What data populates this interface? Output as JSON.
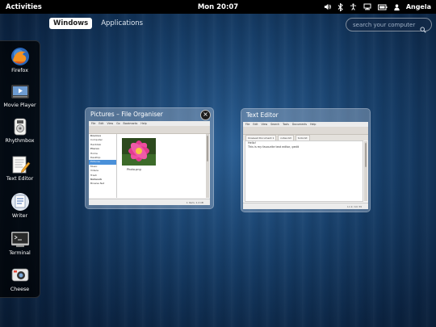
{
  "topbar": {
    "activities_label": "Activities",
    "clock": "Mon 20:07",
    "user_name": "Angela",
    "status_icons": [
      "volume-icon",
      "bluetooth-icon",
      "accessibility-icon",
      "network-icon",
      "battery-icon"
    ]
  },
  "view_tabs": [
    "Windows",
    "Applications"
  ],
  "search": {
    "placeholder": "search your computer"
  },
  "dash": {
    "items": [
      {
        "label": "Firefox",
        "icon": "firefox-icon",
        "running": true
      },
      {
        "label": "Movie Player",
        "icon": "movie-player-icon",
        "running": false
      },
      {
        "label": "Rhythmbox",
        "icon": "rhythmbox-icon",
        "running": false
      },
      {
        "label": "Text Editor",
        "icon": "text-editor-icon",
        "running": true
      },
      {
        "label": "Writer",
        "icon": "writer-icon",
        "running": false
      },
      {
        "label": "Terminal",
        "icon": "terminal-icon",
        "running": true
      },
      {
        "label": "Cheese",
        "icon": "cheese-icon",
        "running": false
      }
    ]
  },
  "windows": {
    "file_organiser": {
      "title": "Pictures – File Organiser",
      "menu": [
        "File",
        "Edit",
        "View",
        "Go",
        "Bookmarks",
        "Help"
      ],
      "sidebar": [
        "Devices",
        "Computer",
        "Harddisk",
        "Places",
        "Home",
        "Desktop",
        "Pictures",
        "Music",
        "Videos",
        "Trash",
        "Network",
        "Browse Net"
      ],
      "file_name": "Photo.png",
      "status": "1 item, 1.4 kB"
    },
    "text_editor": {
      "title": "Text Editor",
      "menu": [
        "File",
        "Edit",
        "View",
        "Search",
        "Tools",
        "Documents",
        "Help"
      ],
      "tabs": [
        "Unsaved Document 1",
        "notes.txt",
        "todo.txt"
      ],
      "lines": [
        "Hello!",
        "This is my favourite text editor, gedit"
      ],
      "status": "Ln 2, Col 39"
    }
  },
  "colors": {
    "panel": "#000000",
    "accent": "#4a90d9",
    "background": "#163d67"
  }
}
